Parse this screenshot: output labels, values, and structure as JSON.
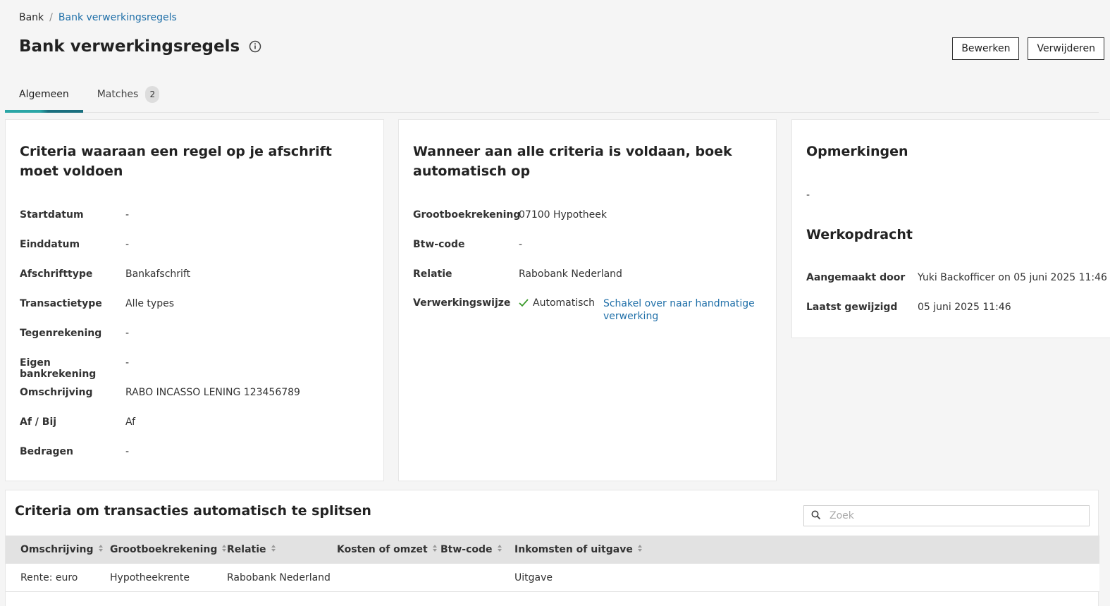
{
  "breadcrumb": {
    "root": "Bank",
    "separator": "/",
    "current": "Bank verwerkingsregels"
  },
  "page": {
    "title": "Bank verwerkingsregels"
  },
  "actions": {
    "edit_label": "Bewerken",
    "delete_label": "Verwijderen"
  },
  "tabs": [
    {
      "label": "Algemeen",
      "active": true
    },
    {
      "label": "Matches",
      "badge": "2",
      "active": false
    }
  ],
  "criteria": {
    "title": "Criteria waaraan een regel op je afschrift moet voldoen",
    "fields": [
      {
        "label": "Startdatum",
        "value": "-"
      },
      {
        "label": "Einddatum",
        "value": "-"
      },
      {
        "label": "Afschrifttype",
        "value": "Bankafschrift"
      },
      {
        "label": "Transactietype",
        "value": "Alle types"
      },
      {
        "label": "Tegenrekening",
        "value": "-"
      },
      {
        "label": "Eigen bankrekening",
        "value": "-"
      },
      {
        "label": "Omschrijving",
        "value": "RABO INCASSO LENING 123456789"
      },
      {
        "label": "Af / Bij",
        "value": "Af"
      },
      {
        "label": "Bedragen",
        "value": "-"
      }
    ]
  },
  "booking": {
    "title": "Wanneer aan alle criteria is voldaan, boek automatisch op",
    "fields": [
      {
        "label": "Grootboekrekening",
        "value": "07100 Hypotheek"
      },
      {
        "label": "Btw-code",
        "value": "-"
      },
      {
        "label": "Relatie",
        "value": "Rabobank Nederland"
      },
      {
        "label": "Verwerkingswijze",
        "value": "Automatisch",
        "link": "Schakel over naar handmatige verwerking"
      }
    ]
  },
  "remarks": {
    "title": "Opmerkingen",
    "value": "-"
  },
  "workorder": {
    "title": "Werkopdracht",
    "fields": [
      {
        "label": "Aangemaakt door",
        "value": "Yuki Backofficer on 05 juni 2025 11:46"
      },
      {
        "label": "Laatst gewijzigd",
        "value": "05 juni 2025 11:46"
      }
    ]
  },
  "split": {
    "title": "Criteria om transacties automatisch te splitsen",
    "search_placeholder": "Zoek",
    "columns": [
      "Omschrijving",
      "Grootboekrekening",
      "Relatie",
      "Kosten of omzet",
      "Btw-code",
      "Inkomsten of uitgave"
    ],
    "rows": [
      [
        "Rente: euro",
        "Hypotheekrente",
        "Rabobank Nederland",
        "",
        "",
        "Uitgave"
      ]
    ]
  },
  "colors": {
    "link": "#1f6fa8",
    "tab_accent": "#2aa6a6",
    "check": "#3a9a2a"
  }
}
